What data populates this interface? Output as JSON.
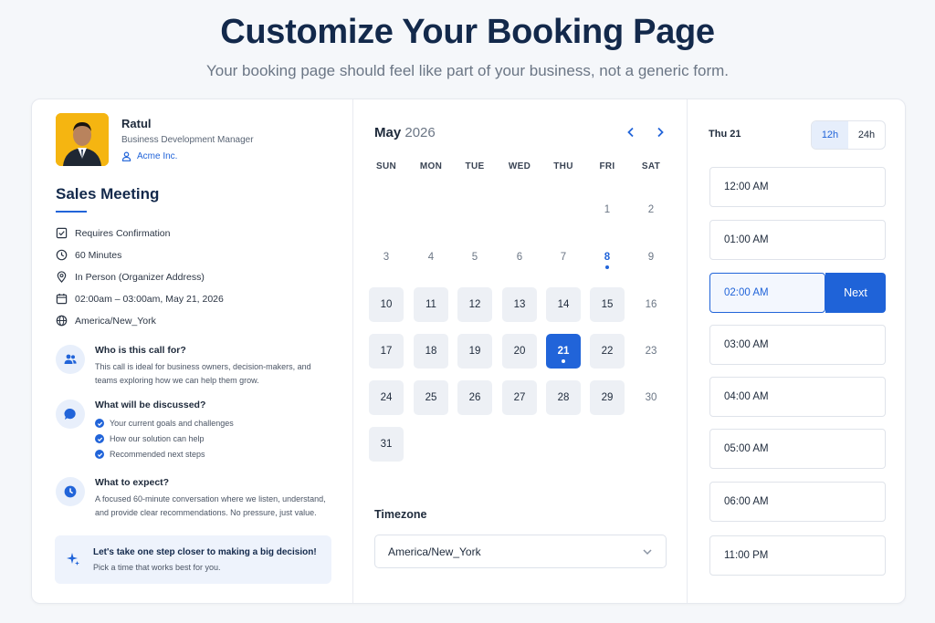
{
  "hero": {
    "title": "Customize Your Booking Page",
    "subtitle": "Your booking page should feel like part of your business, not a generic form."
  },
  "host": {
    "name": "Ratul",
    "role": "Business Development Manager",
    "company": "Acme Inc."
  },
  "event": {
    "title": "Sales Meeting",
    "meta": [
      {
        "icon": "checkbox-icon",
        "text": "Requires Confirmation"
      },
      {
        "icon": "clock-icon",
        "text": "60 Minutes"
      },
      {
        "icon": "location-pin-icon",
        "text": "In Person (Organizer Address)"
      },
      {
        "icon": "calendar-icon",
        "text": "02:00am – 03:00am, May 21, 2026"
      },
      {
        "icon": "globe-icon",
        "text": "America/New_York"
      }
    ]
  },
  "sections": {
    "who": {
      "title": "Who is this call for?",
      "body": "This call is ideal for business owners, decision-makers, and teams exploring how we can help them grow."
    },
    "discussed": {
      "title": "What will be discussed?",
      "items": [
        "Your current goals and challenges",
        "How our solution can help",
        "Recommended next steps"
      ]
    },
    "expect": {
      "title": "What to expect?",
      "body": "A focused 60-minute conversation where we listen, understand, and provide clear recommendations. No pressure, just value."
    }
  },
  "cta": {
    "title": "Let's take one step closer to making a big decision!",
    "subtitle": "Pick a time that works best for you."
  },
  "calendar": {
    "month": "May",
    "year": "2026",
    "weekdays": [
      "SUN",
      "MON",
      "TUE",
      "WED",
      "THU",
      "FRI",
      "SAT"
    ],
    "first_weekday_index": 5,
    "days_in_month": 31,
    "available_days": [
      10,
      11,
      12,
      13,
      14,
      15,
      17,
      18,
      19,
      20,
      22,
      24,
      25,
      26,
      27,
      28,
      29,
      31
    ],
    "today": 8,
    "selected_day": 21
  },
  "timezone": {
    "label": "Timezone",
    "value": "America/New_York"
  },
  "slots_panel": {
    "date_label": "Thu 21",
    "format_options": [
      "12h",
      "24h"
    ],
    "active_format": "12h",
    "slots": [
      "12:00 AM",
      "01:00 AM",
      "02:00 AM",
      "03:00 AM",
      "04:00 AM",
      "05:00 AM",
      "06:00 AM",
      "11:00 PM"
    ],
    "selected_slot": "02:00 AM",
    "next_label": "Next"
  },
  "colors": {
    "accent": "#2164d9",
    "title": "#13294b",
    "available_day_bg": "#edf0f5"
  }
}
